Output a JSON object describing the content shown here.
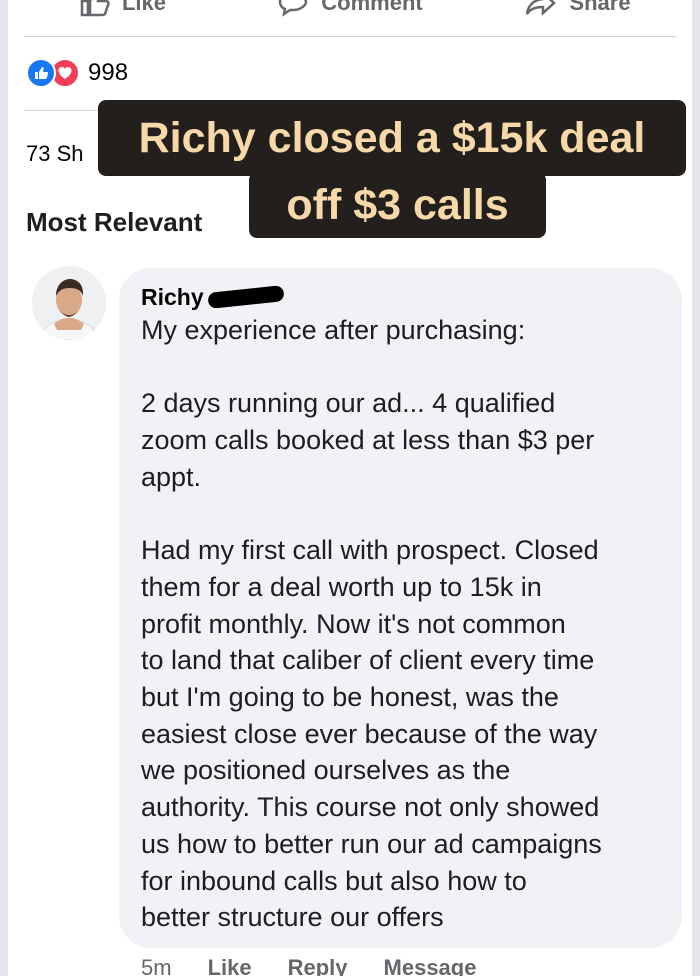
{
  "actions": [
    {
      "label": "Like",
      "icon": "thumbs-up-icon"
    },
    {
      "label": "Comment",
      "icon": "comment-icon"
    },
    {
      "label": "Share",
      "icon": "share-icon"
    }
  ],
  "reactions": {
    "count": "998",
    "icons": [
      "like-reaction-icon",
      "love-reaction-icon"
    ],
    "colors": {
      "like": "#1877f2",
      "love": "#f33e58"
    }
  },
  "shares_label": "73 Sh",
  "sort_label": "Most Relevant",
  "caption": {
    "line1": "Richy closed a $15k deal",
    "line2": "off $3 calls",
    "background": "#231f1c",
    "text_color": "#f7d9a9"
  },
  "comment": {
    "author": "Richy",
    "text": "My experience after purchasing:\n\n2 days running our ad... 4 qualified\nzoom calls booked at less than $3 per\nappt.\n\nHad my first call with prospect. Closed\nthem for a deal worth up to 15k in\nprofit monthly. Now it's not common\nto land that caliber of client every time\nbut I'm going to be honest, was the\neasiest close ever because of the way\nwe positioned ourselves as the\nauthority. This course not only showed\nus how to better run our ad campaigns\nfor inbound calls but also how to\nbetter structure our offers",
    "time": "5m",
    "like_label": "Like",
    "reply_label": "Reply",
    "message_label": "Message"
  }
}
